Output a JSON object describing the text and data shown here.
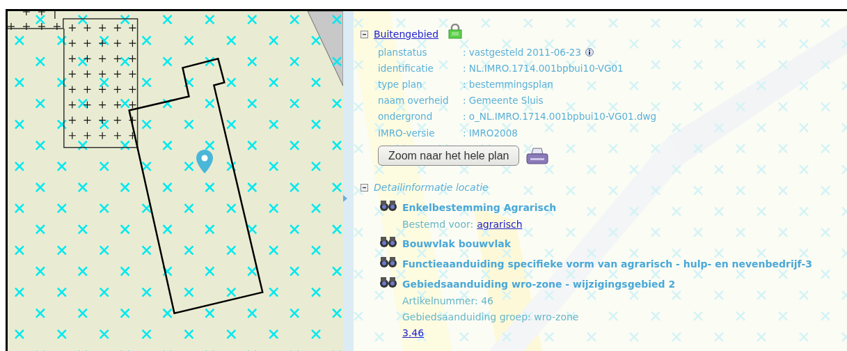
{
  "plan": {
    "title": "Buitengebied",
    "expanded": true,
    "properties": [
      {
        "label": "planstatus",
        "value": ": vastgesteld 2011-06-23",
        "info": true
      },
      {
        "label": "identificatie",
        "value": ": NL.IMRO.1714.001bpbui10-VG01",
        "info": false
      },
      {
        "label": "type plan",
        "value": ": bestemmingsplan",
        "info": false
      },
      {
        "label": "naam overheid",
        "value": ": Gemeente Sluis",
        "info": false
      },
      {
        "label": "ondergrond",
        "value": ": o_NL.IMRO.1714.001bpbui10-VG01.dwg",
        "info": false
      },
      {
        "label": "IMRO-versie",
        "value": ": IMRO2008",
        "info": false
      }
    ],
    "zoom_button": "Zoom naar het hele plan"
  },
  "detail": {
    "title": "Detailinformatie locatie",
    "expanded": true,
    "items": [
      {
        "title": "Enkelbestemming Agrarisch",
        "lines": [
          {
            "text": "Bestemd voor:",
            "link": "agrarisch"
          }
        ]
      },
      {
        "title": "Bouwvlak bouwvlak"
      },
      {
        "title": "Functieaanduiding specifieke vorm van agrarisch - hulp- en nevenbedrijf-3"
      },
      {
        "title": "Gebiedsaanduiding wro-zone - wijzigingsgebied 2",
        "lines": [
          {
            "text": "Artikelnummer: 46"
          },
          {
            "text": "Gebiedsaanduiding groep: wro-zone"
          },
          {
            "link": "3.46"
          }
        ]
      }
    ]
  }
}
